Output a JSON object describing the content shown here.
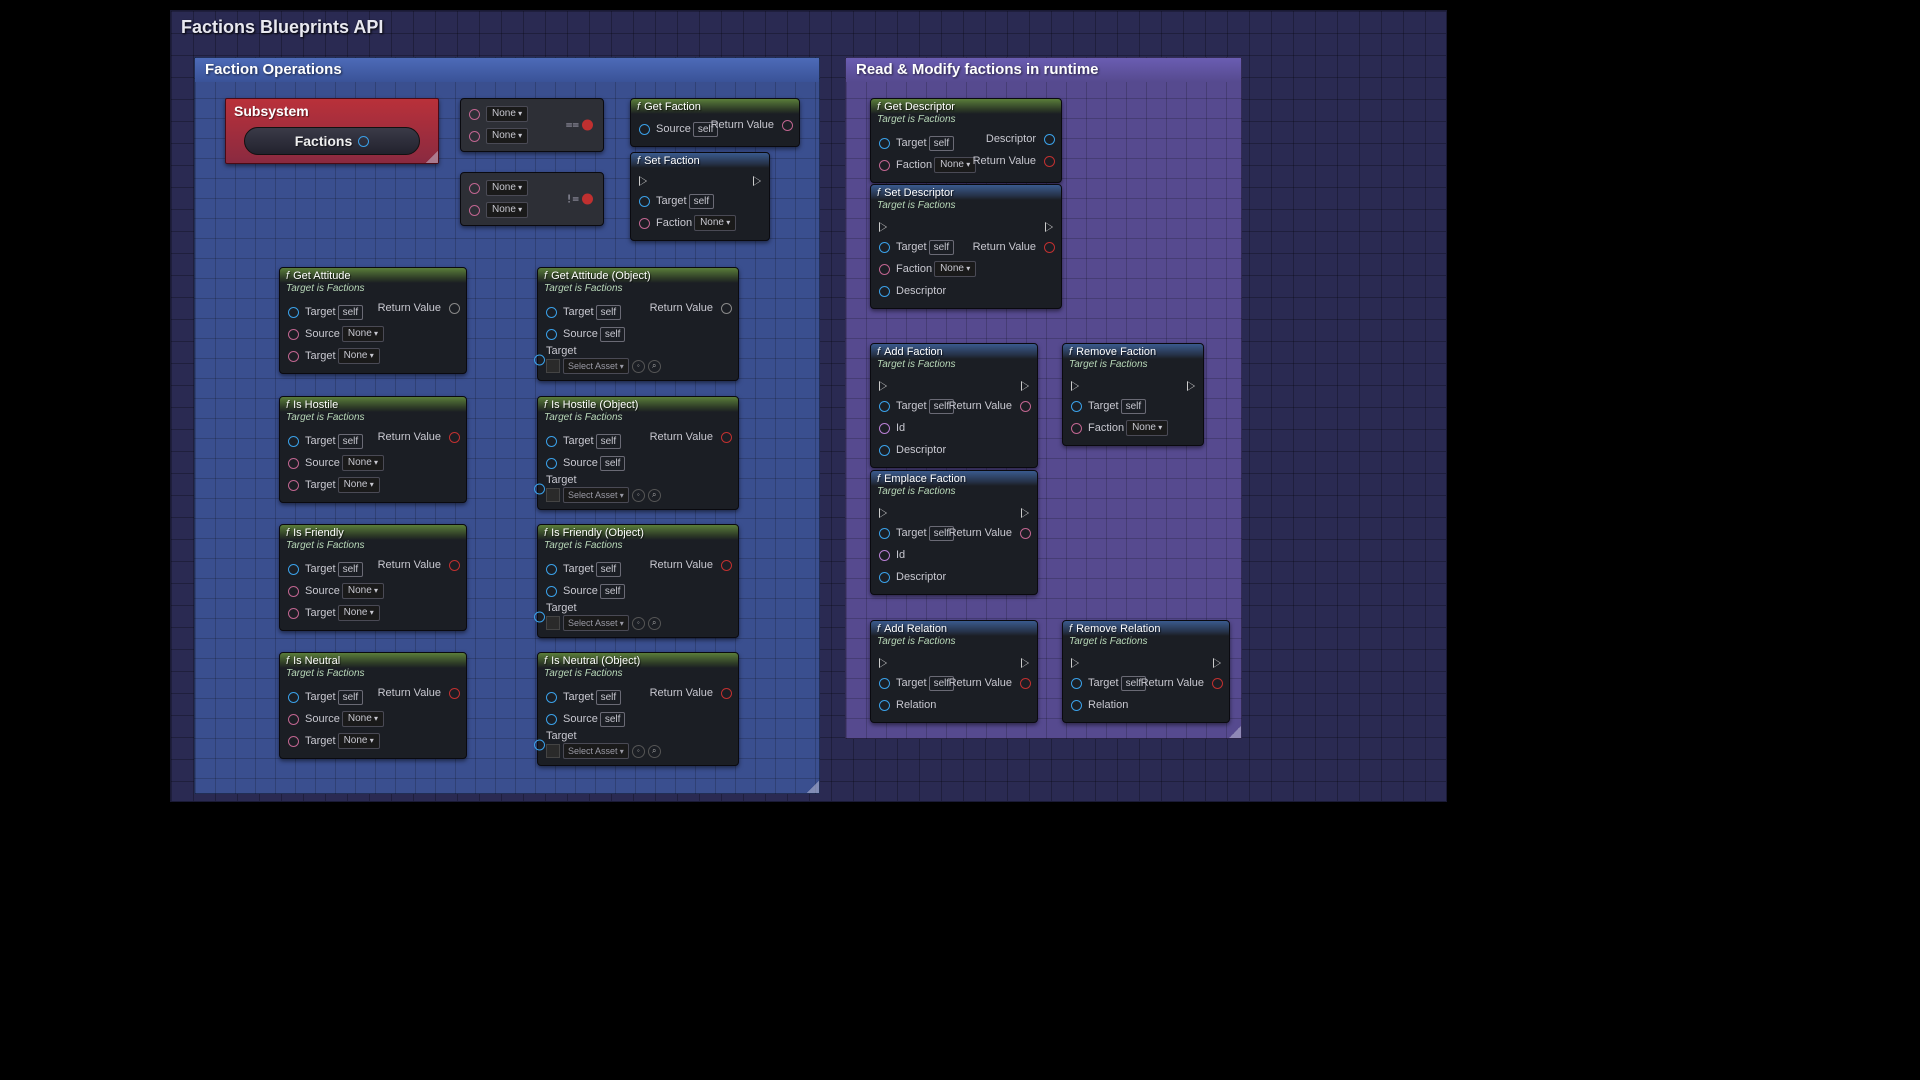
{
  "page_title": "Factions Blueprints API",
  "panels": {
    "operations": {
      "title": "Faction Operations"
    },
    "runtime": {
      "title": "Read & Modify factions in runtime"
    }
  },
  "subsystem": {
    "title": "Subsystem",
    "label": "Factions"
  },
  "common": {
    "target": "Target",
    "source": "Source",
    "faction": "Faction",
    "descriptor": "Descriptor",
    "id": "Id",
    "relation": "Relation",
    "return_value": "Return Value",
    "self": "self",
    "none": "None",
    "select_asset": "Select Asset",
    "target_is_factions": "Target is Factions"
  },
  "op_eq": "==",
  "op_neq": "!=",
  "nodes": {
    "get_faction": "Get Faction",
    "set_faction": "Set Faction",
    "get_attitude": "Get Attitude",
    "get_attitude_obj": "Get Attitude (Object)",
    "is_hostile": "Is Hostile",
    "is_hostile_obj": "Is Hostile (Object)",
    "is_friendly": "Is Friendly",
    "is_friendly_obj": "Is Friendly (Object)",
    "is_neutral": "Is Neutral",
    "is_neutral_obj": "Is Neutral (Object)",
    "get_descriptor": "Get Descriptor",
    "set_descriptor": "Set Descriptor",
    "add_faction": "Add Faction",
    "remove_faction": "Remove Faction",
    "emplace_faction": "Emplace Faction",
    "add_relation": "Add Relation",
    "remove_relation": "Remove Relation"
  }
}
